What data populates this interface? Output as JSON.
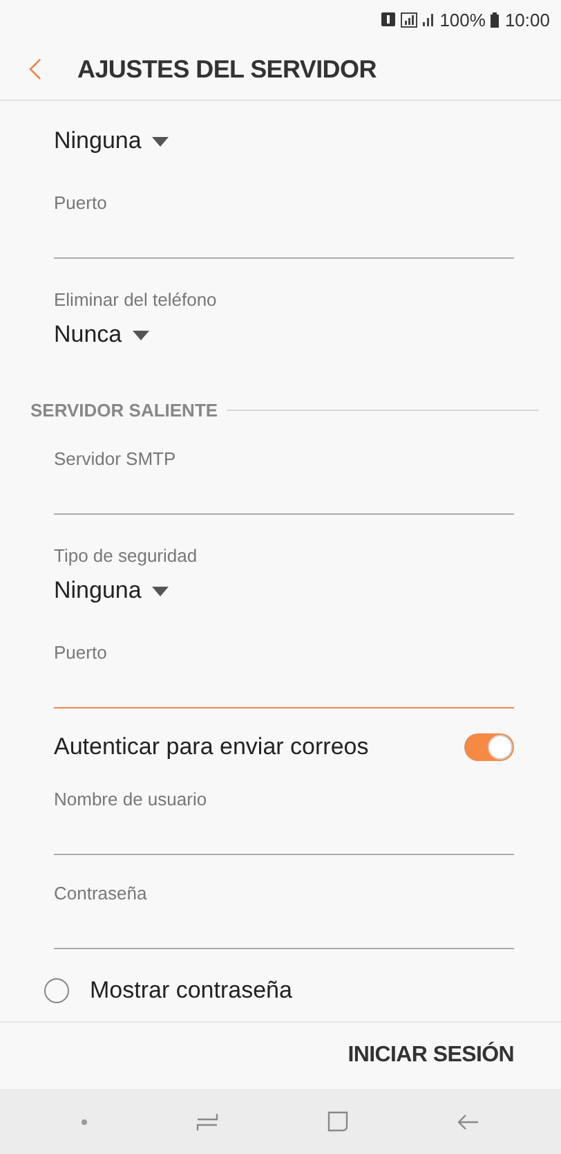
{
  "status_bar": {
    "battery": "100%",
    "time": "10:00"
  },
  "header": {
    "title": "AJUSTES DEL SERVIDOR"
  },
  "items": [
    {
      "kind": "dropdown",
      "value": "Ninguna"
    },
    {
      "kind": "field",
      "label": "Puerto",
      "focused": false
    },
    {
      "kind": "dropdown",
      "label": "Eliminar del teléfono",
      "value": "Nunca"
    },
    {
      "kind": "section",
      "label": "SERVIDOR SALIENTE"
    },
    {
      "kind": "field",
      "label": "Servidor SMTP",
      "focused": false
    },
    {
      "kind": "dropdown",
      "label": "Tipo de seguridad",
      "value": "Ninguna"
    },
    {
      "kind": "field",
      "label": "Puerto",
      "focused": true
    },
    {
      "kind": "toggle",
      "label": "Autenticar para enviar correos",
      "on": true
    },
    {
      "kind": "field",
      "label": "Nombre de usuario",
      "focused": false
    },
    {
      "kind": "field",
      "label": "Contraseña",
      "focused": false
    },
    {
      "kind": "checkbox",
      "label": "Mostrar contraseña",
      "checked": false
    }
  ],
  "footer": {
    "button": "INICIAR SESIÓN"
  }
}
